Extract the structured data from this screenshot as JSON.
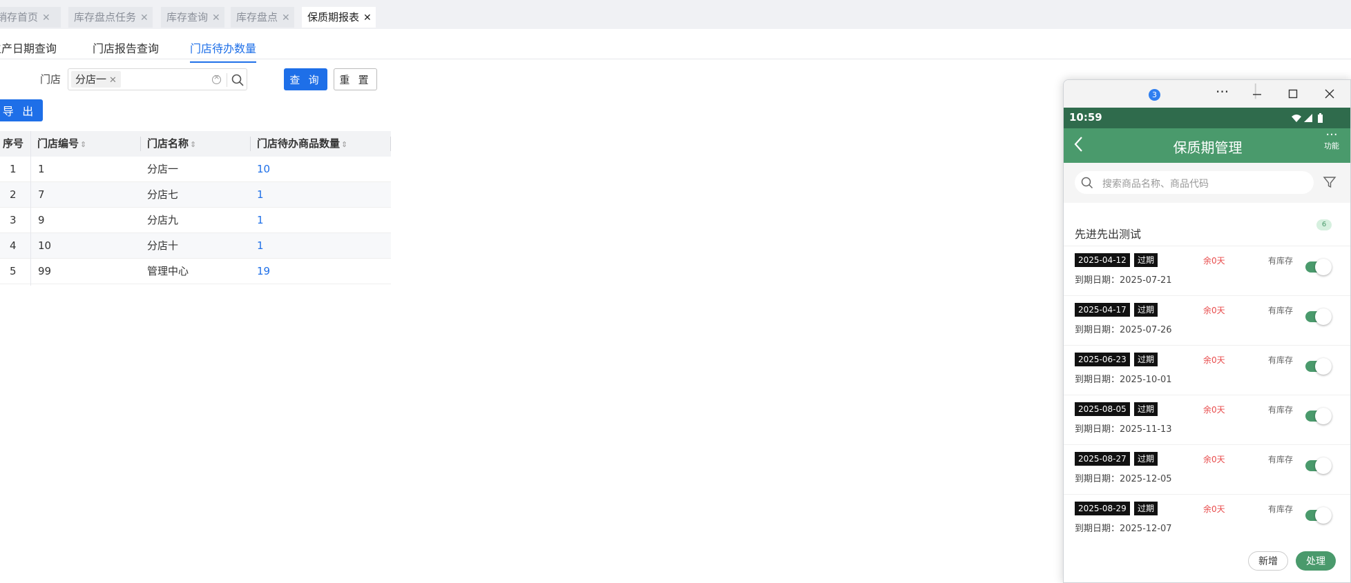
{
  "tabs": [
    {
      "label": "营销存首页"
    },
    {
      "label": "库存盘点任务"
    },
    {
      "label": "库存查询"
    },
    {
      "label": "库存盘点"
    },
    {
      "label": "保质期报表"
    }
  ],
  "subtabs": [
    {
      "label": "生产日期查询"
    },
    {
      "label": "门店报告查询"
    },
    {
      "label": "门店待办数量"
    }
  ],
  "filter": {
    "store_label": "门店",
    "selected_chip": "分店一",
    "query_label": "查 询",
    "reset_label": "重 置"
  },
  "export_label": "导 出",
  "table": {
    "columns": [
      "序号",
      "门店编号",
      "门店名称",
      "门店待办商品数量"
    ],
    "rows": [
      {
        "idx": "1",
        "code": "1",
        "name": "分店一",
        "count": "10"
      },
      {
        "idx": "2",
        "code": "7",
        "name": "分店七",
        "count": "1"
      },
      {
        "idx": "3",
        "code": "9",
        "name": "分店九",
        "count": "1"
      },
      {
        "idx": "4",
        "code": "10",
        "name": "分店十",
        "count": "1"
      },
      {
        "idx": "5",
        "code": "99",
        "name": "管理中心",
        "count": "19"
      }
    ]
  },
  "phone": {
    "window_badge": "3",
    "time": "10:59",
    "title": "保质期管理",
    "more_label": "功能",
    "search_placeholder": "搜索商品名称、商品代码",
    "group_name": "先进先出测试",
    "group_count": "6",
    "items": [
      {
        "date": "2025-04-12",
        "status": "过期",
        "remaining": "余0天",
        "stock": "有库存",
        "due": "到期日期：2025-07-21"
      },
      {
        "date": "2025-04-17",
        "status": "过期",
        "remaining": "余0天",
        "stock": "有库存",
        "due": "到期日期：2025-07-26"
      },
      {
        "date": "2025-06-23",
        "status": "过期",
        "remaining": "余0天",
        "stock": "有库存",
        "due": "到期日期：2025-10-01"
      },
      {
        "date": "2025-08-05",
        "status": "过期",
        "remaining": "余0天",
        "stock": "有库存",
        "due": "到期日期：2025-11-13"
      },
      {
        "date": "2025-08-27",
        "status": "过期",
        "remaining": "余0天",
        "stock": "有库存",
        "due": "到期日期：2025-12-05"
      },
      {
        "date": "2025-08-29",
        "status": "过期",
        "remaining": "余0天",
        "stock": "有库存",
        "due": "到期日期：2025-12-07"
      }
    ],
    "add_label": "新增",
    "handle_label": "处理"
  },
  "colors": {
    "primary": "#1e6fe8",
    "app_green": "#4a9a6c",
    "status_dark_green": "#2f6b4c",
    "expired_red": "#e84b4b"
  }
}
